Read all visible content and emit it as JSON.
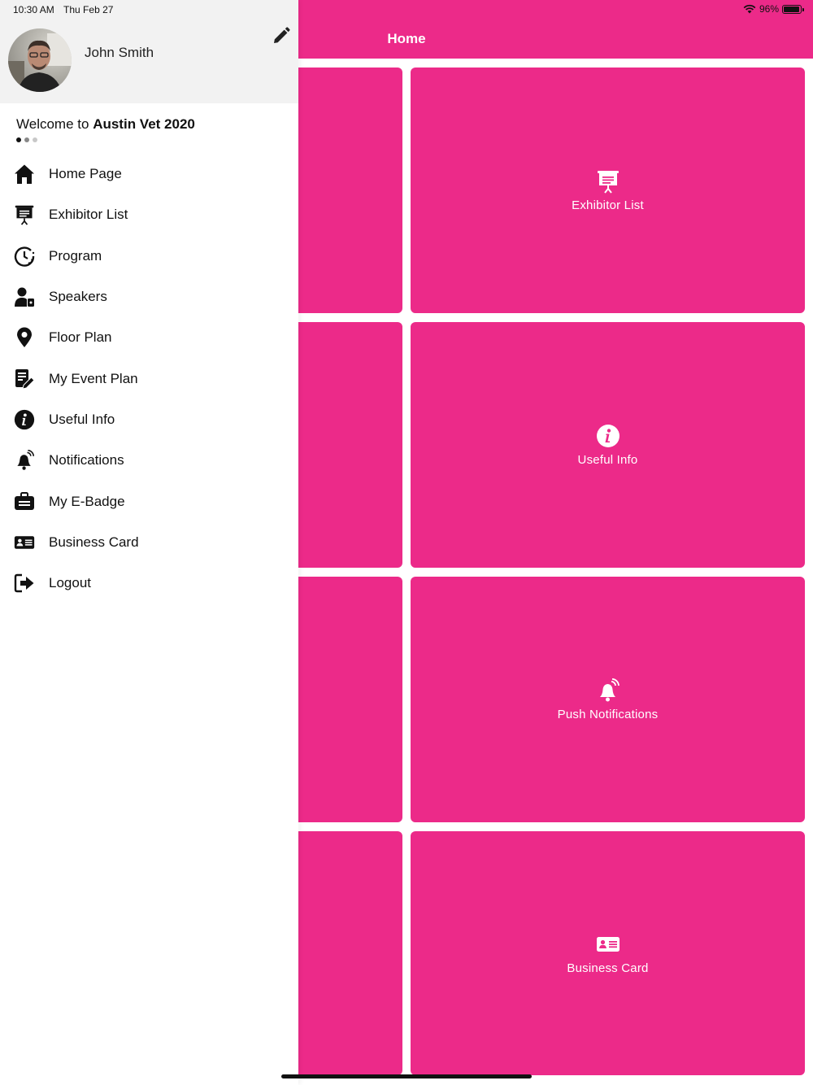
{
  "theme": {
    "accent": "#ec2a89"
  },
  "status_bar": {
    "time": "10:30 AM",
    "date": "Thu Feb 27",
    "battery": "96%",
    "battery_level": 0.96
  },
  "drawer": {
    "user_name": "John Smith",
    "welcome_prefix": "Welcome to",
    "event_name": "Austin Vet 2020",
    "menu": [
      {
        "label": "Home Page",
        "icon": "home-icon"
      },
      {
        "label": "Exhibitor List",
        "icon": "presentation-board-icon"
      },
      {
        "label": "Program",
        "icon": "clock-icon"
      },
      {
        "label": "Speakers",
        "icon": "speaker-person-icon"
      },
      {
        "label": "Floor Plan",
        "icon": "map-pin-icon"
      },
      {
        "label": "My Event Plan",
        "icon": "document-edit-icon"
      },
      {
        "label": "Useful Info",
        "icon": "info-icon"
      },
      {
        "label": "Notifications",
        "icon": "bell-ringing-icon"
      },
      {
        "label": "My E-Badge",
        "icon": "badge-icon"
      },
      {
        "label": "Business Card",
        "icon": "id-card-icon"
      },
      {
        "label": "Logout",
        "icon": "logout-icon"
      }
    ]
  },
  "main": {
    "title": "Home",
    "tiles": [
      {
        "label": "Exhibitor List",
        "icon": "presentation-board-icon"
      },
      {
        "label": "Useful Info",
        "icon": "info-icon"
      },
      {
        "label": "Push Notifications",
        "icon": "bell-ringing-icon"
      },
      {
        "label": "Business Card",
        "icon": "id-card-icon"
      }
    ]
  }
}
